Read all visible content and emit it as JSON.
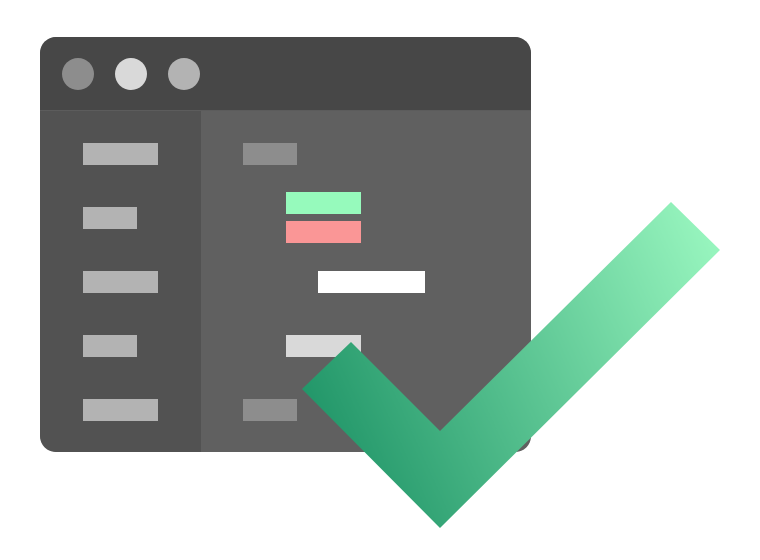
{
  "window": {
    "titlebar": {
      "buttons": [
        {
          "icon": "circle-icon",
          "color": "#8d8d8d"
        },
        {
          "icon": "circle-icon",
          "color": "#d9d9d9"
        },
        {
          "icon": "circle-icon",
          "color": "#b3b3b3"
        }
      ]
    },
    "sidebar": {
      "placeholder_color": "#b3b3b3",
      "item_count": 5
    },
    "main": {
      "header_color": "#8d8d8d",
      "added_line_color": "#96fabc",
      "removed_line_color": "#fa9696",
      "highlight_color": "#ffffff",
      "light_line_color": "#d9d9d9",
      "footer_color": "#8d8d8d"
    },
    "colors": {
      "titlebar": "#474747",
      "sidebar": "#525252",
      "main": "#606060"
    }
  },
  "checkmark": {
    "icon": "checkmark-icon",
    "gradient_start": "#1f9467",
    "gradient_end": "#9af7c0"
  }
}
